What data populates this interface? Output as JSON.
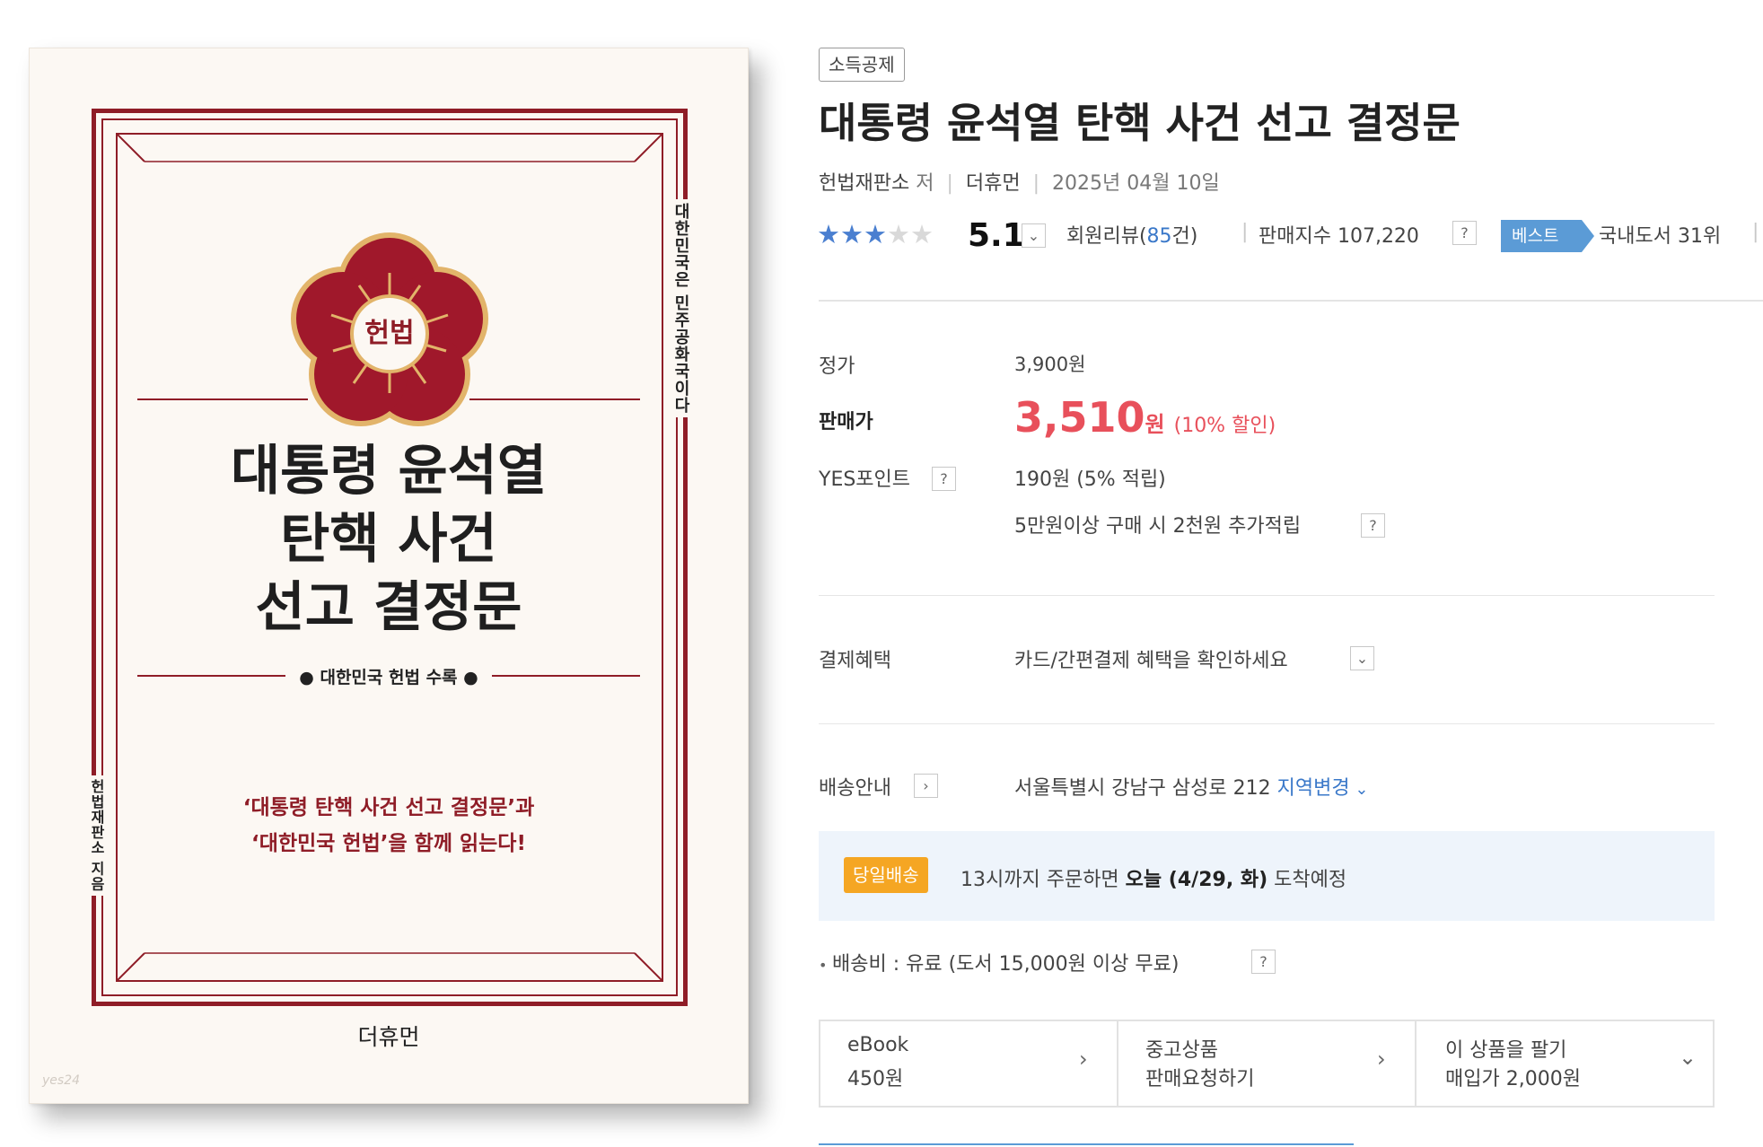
{
  "cover": {
    "emblem_text": "헌법",
    "title_line1": "대통령 윤석열",
    "title_line2": "탄핵 사건",
    "title_line3": "선고 결정문",
    "subline": "● 대한민국 헌법 수록 ●",
    "tagline1": "‘대통령 탄핵 사건 선고 결정문’과",
    "tagline2": "‘대한민국 헌법’을 함께 읽는다!",
    "vertical_right": "대한민국은 민주공화국이다",
    "vertical_left": "헌법재판소 지음",
    "publisher": "더휴먼",
    "watermark": "yes24",
    "colors": {
      "accent": "#8f1d27",
      "gold": "#e2b46a",
      "background": "#fcf8f3"
    }
  },
  "product": {
    "tag": "소득공제",
    "title": "대통령 윤석열 탄핵 사건 선고 결정문",
    "author": "헌법재판소",
    "author_suffix": "저",
    "publisher": "더휴먼",
    "pub_date": "2025년 04월 10일",
    "rating_stars_filled": 3,
    "rating_stars_total": 5,
    "rating": "5.1",
    "review_label": "회원리뷰(",
    "review_count": "85",
    "review_suffix": "건)",
    "sales_index_label": "판매지수 107,220",
    "best_badge": "베스트",
    "best_rank": "국내도서 31위",
    "help_mark": "?",
    "icons": {
      "dropdown": "chevron-down-icon",
      "arrow": "chevron-right-icon"
    }
  },
  "price": {
    "list_label": "정가",
    "list_price": "3,900원",
    "sale_label": "판매가",
    "sale_price": "3,510",
    "sale_unit": "원",
    "discount": "(10% 할인)",
    "point_label": "YES포인트",
    "point_value": "190원 (5% 적립)",
    "extra_point": "5만원이상 구매 시 2천원 추가적립",
    "accent_color": "#e8505b"
  },
  "payment": {
    "label": "결제혜택",
    "value": "카드/간편결제 혜택을 확인하세요"
  },
  "delivery": {
    "label": "배송안내",
    "address": "서울특별시 강남구 삼성로 212",
    "change_region": "지역변경",
    "same_day_badge": "당일배송",
    "notice_pre": "13시까지 주문하면 ",
    "notice_bold": "오늘 (4/29, 화)",
    "notice_post": " 도착예정",
    "fee": "배송비 : 유료 (도서 15,000원 이상 무료)"
  },
  "options": [
    {
      "line1": "eBook",
      "line2": "450원"
    },
    {
      "line1": "중고상품",
      "line2": "판매요청하기"
    },
    {
      "line1": "이 상품을 팔기",
      "line2": "매입가 2,000원"
    }
  ]
}
